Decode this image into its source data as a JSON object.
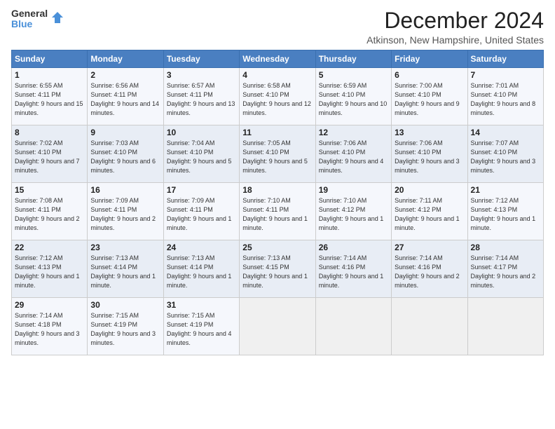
{
  "logo": {
    "general": "General",
    "blue": "Blue"
  },
  "title": "December 2024",
  "location": "Atkinson, New Hampshire, United States",
  "days_of_week": [
    "Sunday",
    "Monday",
    "Tuesday",
    "Wednesday",
    "Thursday",
    "Friday",
    "Saturday"
  ],
  "weeks": [
    [
      {
        "day": "1",
        "sunrise": "6:55 AM",
        "sunset": "4:11 PM",
        "daylight": "9 hours and 15 minutes"
      },
      {
        "day": "2",
        "sunrise": "6:56 AM",
        "sunset": "4:11 PM",
        "daylight": "9 hours and 14 minutes"
      },
      {
        "day": "3",
        "sunrise": "6:57 AM",
        "sunset": "4:11 PM",
        "daylight": "9 hours and 13 minutes"
      },
      {
        "day": "4",
        "sunrise": "6:58 AM",
        "sunset": "4:10 PM",
        "daylight": "9 hours and 12 minutes"
      },
      {
        "day": "5",
        "sunrise": "6:59 AM",
        "sunset": "4:10 PM",
        "daylight": "9 hours and 10 minutes"
      },
      {
        "day": "6",
        "sunrise": "7:00 AM",
        "sunset": "4:10 PM",
        "daylight": "9 hours and 9 minutes"
      },
      {
        "day": "7",
        "sunrise": "7:01 AM",
        "sunset": "4:10 PM",
        "daylight": "9 hours and 8 minutes"
      }
    ],
    [
      {
        "day": "8",
        "sunrise": "7:02 AM",
        "sunset": "4:10 PM",
        "daylight": "9 hours and 7 minutes"
      },
      {
        "day": "9",
        "sunrise": "7:03 AM",
        "sunset": "4:10 PM",
        "daylight": "9 hours and 6 minutes"
      },
      {
        "day": "10",
        "sunrise": "7:04 AM",
        "sunset": "4:10 PM",
        "daylight": "9 hours and 5 minutes"
      },
      {
        "day": "11",
        "sunrise": "7:05 AM",
        "sunset": "4:10 PM",
        "daylight": "9 hours and 5 minutes"
      },
      {
        "day": "12",
        "sunrise": "7:06 AM",
        "sunset": "4:10 PM",
        "daylight": "9 hours and 4 minutes"
      },
      {
        "day": "13",
        "sunrise": "7:06 AM",
        "sunset": "4:10 PM",
        "daylight": "9 hours and 3 minutes"
      },
      {
        "day": "14",
        "sunrise": "7:07 AM",
        "sunset": "4:10 PM",
        "daylight": "9 hours and 3 minutes"
      }
    ],
    [
      {
        "day": "15",
        "sunrise": "7:08 AM",
        "sunset": "4:11 PM",
        "daylight": "9 hours and 2 minutes"
      },
      {
        "day": "16",
        "sunrise": "7:09 AM",
        "sunset": "4:11 PM",
        "daylight": "9 hours and 2 minutes"
      },
      {
        "day": "17",
        "sunrise": "7:09 AM",
        "sunset": "4:11 PM",
        "daylight": "9 hours and 1 minute"
      },
      {
        "day": "18",
        "sunrise": "7:10 AM",
        "sunset": "4:11 PM",
        "daylight": "9 hours and 1 minute"
      },
      {
        "day": "19",
        "sunrise": "7:10 AM",
        "sunset": "4:12 PM",
        "daylight": "9 hours and 1 minute"
      },
      {
        "day": "20",
        "sunrise": "7:11 AM",
        "sunset": "4:12 PM",
        "daylight": "9 hours and 1 minute"
      },
      {
        "day": "21",
        "sunrise": "7:12 AM",
        "sunset": "4:13 PM",
        "daylight": "9 hours and 1 minute"
      }
    ],
    [
      {
        "day": "22",
        "sunrise": "7:12 AM",
        "sunset": "4:13 PM",
        "daylight": "9 hours and 1 minute"
      },
      {
        "day": "23",
        "sunrise": "7:13 AM",
        "sunset": "4:14 PM",
        "daylight": "9 hours and 1 minute"
      },
      {
        "day": "24",
        "sunrise": "7:13 AM",
        "sunset": "4:14 PM",
        "daylight": "9 hours and 1 minute"
      },
      {
        "day": "25",
        "sunrise": "7:13 AM",
        "sunset": "4:15 PM",
        "daylight": "9 hours and 1 minute"
      },
      {
        "day": "26",
        "sunrise": "7:14 AM",
        "sunset": "4:16 PM",
        "daylight": "9 hours and 1 minute"
      },
      {
        "day": "27",
        "sunrise": "7:14 AM",
        "sunset": "4:16 PM",
        "daylight": "9 hours and 2 minutes"
      },
      {
        "day": "28",
        "sunrise": "7:14 AM",
        "sunset": "4:17 PM",
        "daylight": "9 hours and 2 minutes"
      }
    ],
    [
      {
        "day": "29",
        "sunrise": "7:14 AM",
        "sunset": "4:18 PM",
        "daylight": "9 hours and 3 minutes"
      },
      {
        "day": "30",
        "sunrise": "7:15 AM",
        "sunset": "4:19 PM",
        "daylight": "9 hours and 3 minutes"
      },
      {
        "day": "31",
        "sunrise": "7:15 AM",
        "sunset": "4:19 PM",
        "daylight": "9 hours and 4 minutes"
      },
      null,
      null,
      null,
      null
    ]
  ]
}
